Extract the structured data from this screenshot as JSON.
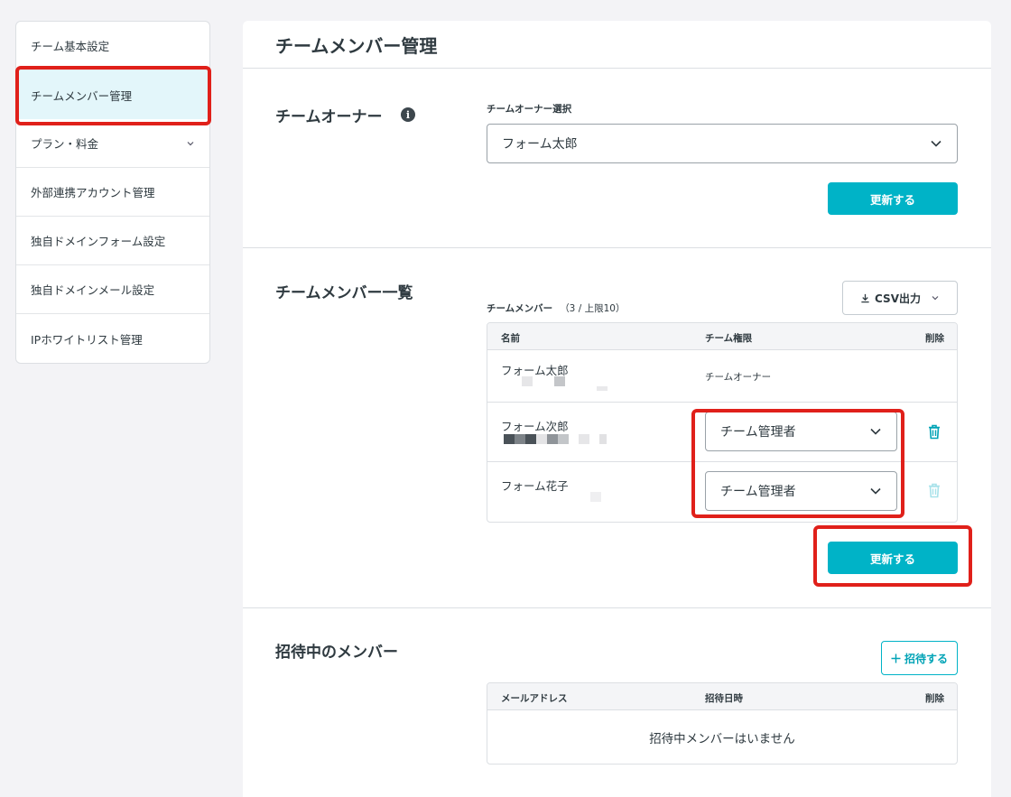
{
  "sidebar": {
    "items": [
      {
        "label": "チーム基本設定"
      },
      {
        "label": "チームメンバー管理"
      },
      {
        "label": "プラン・料金"
      },
      {
        "label": "外部連携アカウント管理"
      },
      {
        "label": "独自ドメインフォーム設定"
      },
      {
        "label": "独自ドメインメール設定"
      },
      {
        "label": "IPホワイトリスト管理"
      }
    ]
  },
  "page": {
    "title": "チームメンバー管理"
  },
  "owner_section": {
    "title": "チームオーナー",
    "select_label": "チームオーナー選択",
    "selected": "フォーム太郎",
    "update_label": "更新する"
  },
  "members_section": {
    "title": "チームメンバー一覧",
    "list_label": "チームメンバー",
    "count": "（3 / 上限10）",
    "csv_label": "CSV出力",
    "columns": {
      "name": "名前",
      "role": "チーム権限",
      "delete": "削除"
    },
    "rows": [
      {
        "name": "フォーム太郎",
        "role": "チームオーナー"
      },
      {
        "name": "フォーム次郎",
        "role": "チーム管理者"
      },
      {
        "name": "フォーム花子",
        "role": "チーム管理者"
      }
    ],
    "update_label": "更新する"
  },
  "invite_section": {
    "title": "招待中のメンバー",
    "invite_label": "招待する",
    "columns": {
      "email": "メールアドレス",
      "date": "招待日時",
      "delete": "削除"
    },
    "empty": "招待中メンバーはいません"
  },
  "colors": {
    "accent": "#00b3c7",
    "highlight": "#e0201a",
    "active_bg": "#e3f6fa"
  }
}
